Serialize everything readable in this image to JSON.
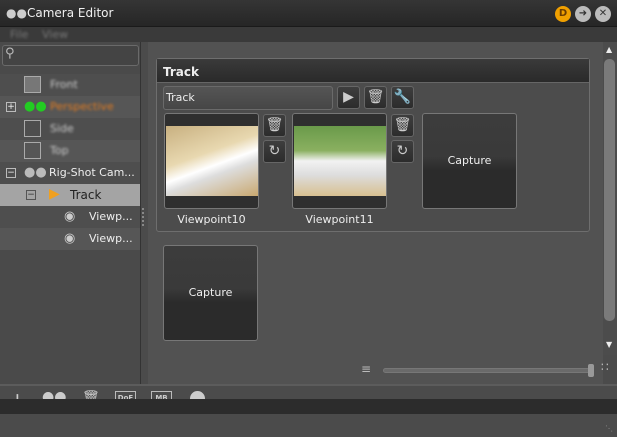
{
  "window": {
    "title": "Camera Editor",
    "badge": "D"
  },
  "menu": [
    "File",
    "View"
  ],
  "search": {
    "placeholder": ""
  },
  "tree": [
    {
      "label": "Front",
      "icon": "cube-icon"
    },
    {
      "label": "Perspective",
      "icon": "camera-icon"
    },
    {
      "label": "Side",
      "icon": "cube-icon"
    },
    {
      "label": "Top",
      "icon": "cube-icon"
    },
    {
      "label": "Rig-Shot Cam...",
      "icon": "camera-icon"
    },
    {
      "label": "Track",
      "icon": "play-icon"
    },
    {
      "label": "Viewp...",
      "icon": "eye-icon"
    },
    {
      "label": "Viewp...",
      "icon": "eye-icon"
    }
  ],
  "track": {
    "header": "Track",
    "name_value": "Track",
    "viewpoints": [
      {
        "label": "Viewpoint10"
      },
      {
        "label": "Viewpoint11"
      }
    ],
    "capture_label": "Capture"
  },
  "capture2_label": "Capture",
  "zoom_slider": {
    "value": 1.0
  },
  "toolbar": {
    "dof": "DoF",
    "mb": "MB"
  }
}
